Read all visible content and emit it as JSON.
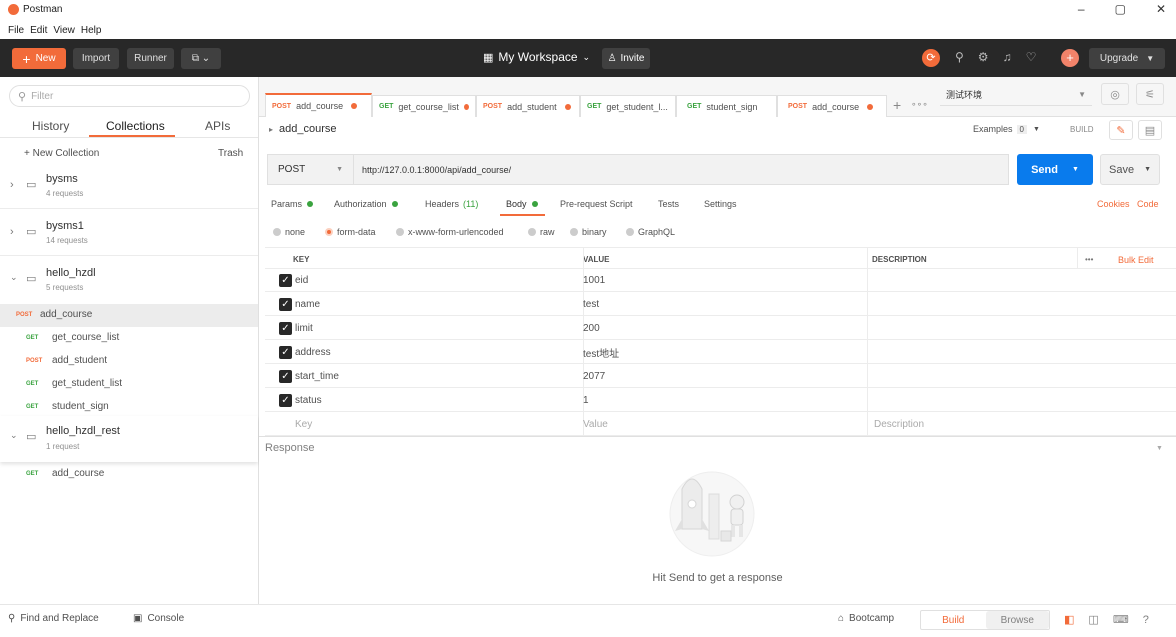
{
  "window": {
    "title": "Postman",
    "menu": [
      "File",
      "Edit",
      "View",
      "Help"
    ]
  },
  "topbar": {
    "new_label": "New",
    "import_label": "Import",
    "runner_label": "Runner",
    "workspace_label": "My Workspace",
    "invite_label": "Invite",
    "upgrade_label": "Upgrade"
  },
  "sidebar": {
    "filter_placeholder": "Filter",
    "tabs": [
      "History",
      "Collections",
      "APIs"
    ],
    "new_collection_label": "+ New Collection",
    "trash_label": "Trash",
    "collections": [
      {
        "name": "bysms",
        "count": "4 requests"
      },
      {
        "name": "bysms1",
        "count": "14 requests"
      },
      {
        "name": "hello_hzdl",
        "count": "5 requests"
      },
      {
        "name": "hello_hzdl_rest",
        "count": "1 request"
      }
    ],
    "hello_hzdl_requests": [
      {
        "method": "POST",
        "name": "add_course"
      },
      {
        "method": "GET",
        "name": "get_course_list"
      },
      {
        "method": "POST",
        "name": "add_student"
      },
      {
        "method": "GET",
        "name": "get_student_list"
      },
      {
        "method": "GET",
        "name": "student_sign"
      }
    ],
    "hello_hzdl_rest_requests": [
      {
        "method": "GET",
        "name": "add_course"
      }
    ]
  },
  "tabs": [
    {
      "method": "POST",
      "name": "add_course"
    },
    {
      "method": "GET",
      "name": "get_course_list"
    },
    {
      "method": "POST",
      "name": "add_student"
    },
    {
      "method": "GET",
      "name": "get_student_l..."
    },
    {
      "method": "GET",
      "name": "student_sign"
    },
    {
      "method": "POST",
      "name": "add_course"
    }
  ],
  "environment": {
    "selected": "测试环境"
  },
  "request": {
    "name": "add_course",
    "examples_label": "Examples",
    "examples_count": "0",
    "build_label": "BUILD",
    "method": "POST",
    "url": "http://127.0.0.1:8000/api/add_course/",
    "send_label": "Send",
    "save_label": "Save",
    "subtabs": {
      "params": "Params",
      "authorization": "Authorization",
      "headers": "Headers",
      "headers_count": "(11)",
      "body": "Body",
      "prerequest": "Pre-request Script",
      "tests": "Tests",
      "settings": "Settings"
    },
    "cookies_label": "Cookies",
    "code_label": "Code",
    "body_types": [
      "none",
      "form-data",
      "x-www-form-urlencoded",
      "raw",
      "binary",
      "GraphQL"
    ],
    "table": {
      "headers": {
        "key": "KEY",
        "value": "VALUE",
        "description": "DESCRIPTION"
      },
      "bulk_edit": "Bulk Edit",
      "more": "•••",
      "rows": [
        {
          "key": "eid",
          "value": "1001"
        },
        {
          "key": "name",
          "value": "test"
        },
        {
          "key": "limit",
          "value": "200"
        },
        {
          "key": "address",
          "value": "test地址"
        },
        {
          "key": "start_time",
          "value": "2077"
        },
        {
          "key": "status",
          "value": "1"
        }
      ],
      "placeholder": {
        "key": "Key",
        "value": "Value",
        "description": "Description"
      }
    }
  },
  "response": {
    "label": "Response",
    "hint": "Hit Send to get a response"
  },
  "statusbar": {
    "find_replace": "Find and Replace",
    "console": "Console",
    "bootcamp": "Bootcamp",
    "build": "Build",
    "browse": "Browse"
  },
  "colors": {
    "accent": "#f26b3a",
    "send": "#097bed",
    "dark": "#282828",
    "get": "#3aa33f"
  }
}
